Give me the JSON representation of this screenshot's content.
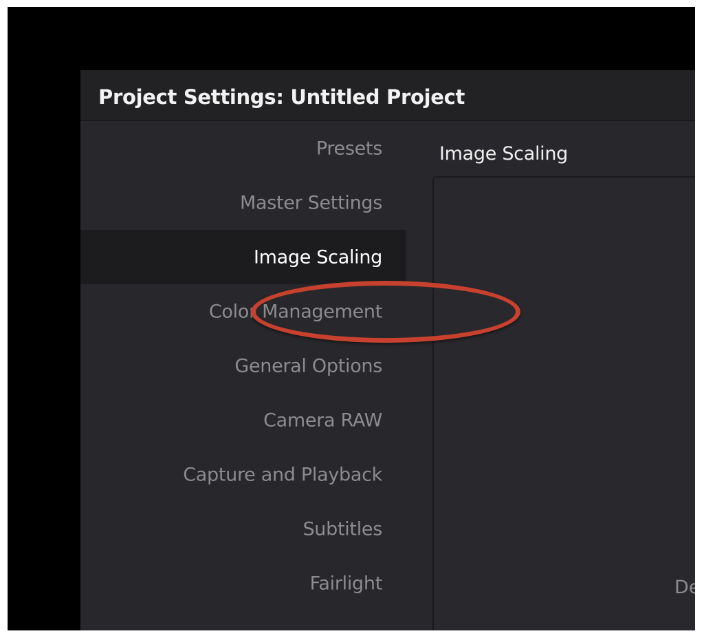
{
  "window": {
    "title": "Project Settings:  Untitled Project"
  },
  "sidebar": {
    "items": [
      {
        "label": "Presets",
        "active": false
      },
      {
        "label": "Master Settings",
        "active": false
      },
      {
        "label": "Image Scaling",
        "active": true
      },
      {
        "label": "Color Management",
        "active": false
      },
      {
        "label": "General Options",
        "active": false
      },
      {
        "label": "Camera RAW",
        "active": false
      },
      {
        "label": "Capture and Playback",
        "active": false
      },
      {
        "label": "Subtitles",
        "active": false
      },
      {
        "label": "Fairlight",
        "active": false
      }
    ]
  },
  "main": {
    "section_title": "Image Scaling",
    "clipped_label": "De"
  },
  "annotation": {
    "highlight_color": "#c8412e",
    "highlight_target": "Image Scaling"
  },
  "colors": {
    "dialog_bg": "#28282c",
    "titlebar_bg": "#222225",
    "active_item_bg": "#1c1c1e",
    "inactive_text": "#8c8c90",
    "active_text": "#ffffff"
  }
}
